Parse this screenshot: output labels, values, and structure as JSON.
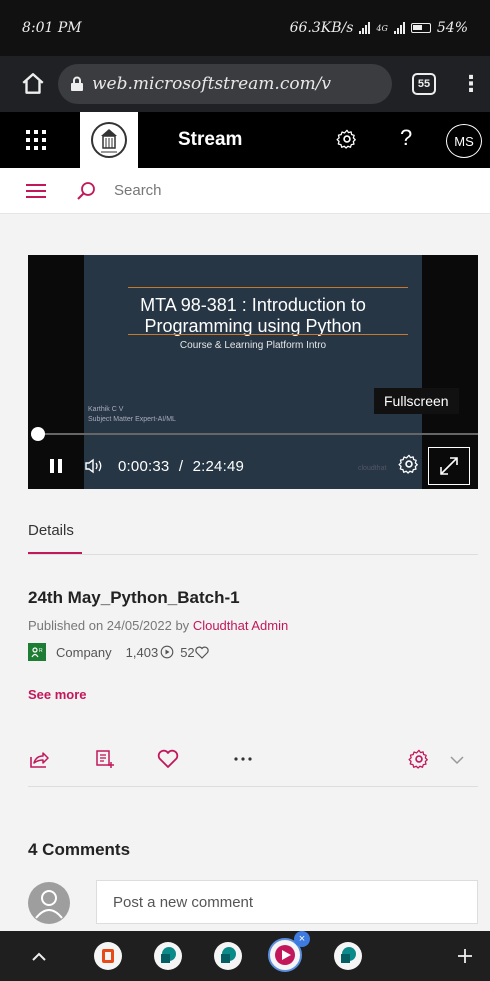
{
  "status_bar": {
    "time": "8:01 PM",
    "network_speed": "66.3KB/s",
    "network_type": "4G",
    "battery": "54%"
  },
  "browser": {
    "url": "web.microsoftstream.com/v",
    "tab_count": "55"
  },
  "app_header": {
    "title": "Stream",
    "avatar_initials": "MS"
  },
  "search": {
    "placeholder": "Search"
  },
  "player": {
    "slide_title_line1": "MTA 98-381 : Introduction to",
    "slide_title_line2": "Programming using Python",
    "slide_subtitle": "Course & Learning Platform Intro",
    "presenter_name": "Karthik C V",
    "presenter_role": "Subject Matter Expert-AI/ML",
    "watermark": "cloudthat",
    "current_time": "0:00:33",
    "separator": "/",
    "total_time": "2:24:49",
    "progress_fraction": 0.004,
    "fullscreen_tooltip": "Fullscreen"
  },
  "details": {
    "tab_label": "Details",
    "video_title": "24th May_Python_Batch-1",
    "published_prefix": "Published on 24/05/2022 by",
    "author": "Cloudthat Admin",
    "visibility": "Company",
    "views": "1,403",
    "likes": "52",
    "see_more": "See more"
  },
  "comments": {
    "heading": "4 Comments",
    "placeholder": "Post a new comment"
  },
  "colors": {
    "accent": "#c2185b",
    "header_bg": "#000000",
    "company_badge": "#1e7d34"
  }
}
